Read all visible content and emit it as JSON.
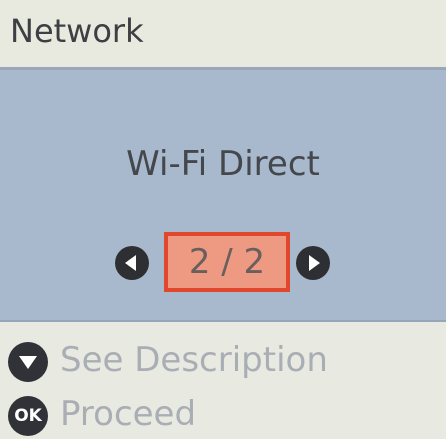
{
  "header": {
    "title": "Network"
  },
  "main": {
    "option_title": "Wi-Fi Direct",
    "pager": {
      "current": 2,
      "total": 2,
      "text": "2 / 2"
    }
  },
  "footer": {
    "see_description": {
      "icon": "down-arrow-icon",
      "label": "See Description"
    },
    "proceed": {
      "icon": "ok-button-icon",
      "icon_text": "OK",
      "label": "Proceed"
    }
  },
  "colors": {
    "header_bg": "#e8eadf",
    "panel_bg": "#a8b9ce",
    "highlight_fill": "#ee9a82",
    "highlight_border": "#e0472c",
    "footer_text": "#a9aeb5"
  }
}
